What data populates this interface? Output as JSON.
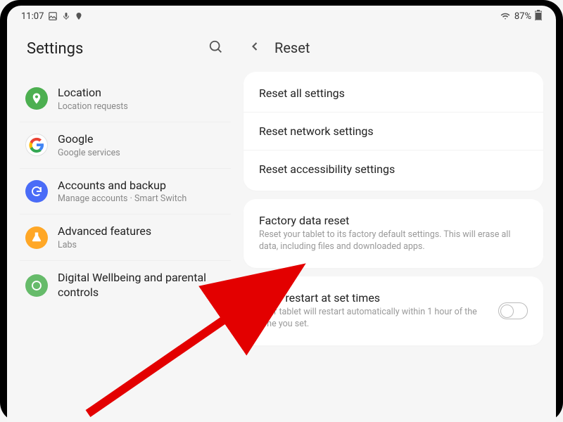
{
  "statusbar": {
    "time": "11:07",
    "battery_pct": "87%"
  },
  "left": {
    "title": "Settings",
    "items": [
      {
        "title": "Location",
        "subtitle": "Location requests"
      },
      {
        "title": "Google",
        "subtitle": "Google services"
      },
      {
        "title": "Accounts and backup",
        "subtitle": "Manage accounts · Smart Switch"
      },
      {
        "title": "Advanced features",
        "subtitle": "Labs"
      },
      {
        "title": "Digital Wellbeing and parental controls",
        "subtitle": ""
      }
    ]
  },
  "right": {
    "title": "Reset",
    "group1": [
      {
        "title": "Reset all settings"
      },
      {
        "title": "Reset network settings"
      },
      {
        "title": "Reset accessibility settings"
      }
    ],
    "factory": {
      "title": "Factory data reset",
      "subtitle": "Reset your tablet to its factory default settings. This will erase all data, including files and downloaded apps."
    },
    "autorestart": {
      "title": "Auto restart at set times",
      "subtitle": "Your tablet will restart automatically within 1 hour of the time you set."
    }
  }
}
